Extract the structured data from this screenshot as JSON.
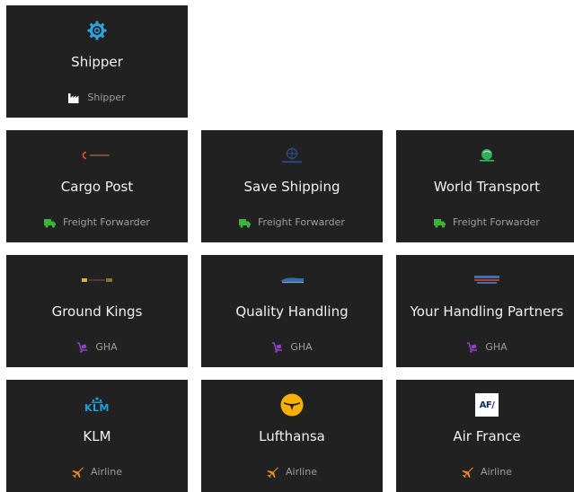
{
  "colors": {
    "tile_bg": "#212121",
    "shipper_icon": "#2ea3dd",
    "forwarder_icon": "#3cb43c",
    "gha_icon": "#8e44c8",
    "airline_icon": "#f08a24",
    "lufthansa_yellow": "#f9b000"
  },
  "tiles": [
    {
      "name": "Shipper",
      "role": "Shipper",
      "role_icon": "factory-icon",
      "logo": "gear-icon"
    },
    {
      "name": "Cargo Post",
      "role": "Freight Forwarder",
      "role_icon": "truck-icon",
      "logo": "cargo-post-logo"
    },
    {
      "name": "Save Shipping",
      "role": "Freight Forwarder",
      "role_icon": "truck-icon",
      "logo": "save-shipping-logo"
    },
    {
      "name": "World Transport",
      "role": "Freight Forwarder",
      "role_icon": "truck-icon",
      "logo": "world-transport-logo"
    },
    {
      "name": "Ground Kings",
      "role": "GHA",
      "role_icon": "dolly-icon",
      "logo": "ground-kings-logo"
    },
    {
      "name": "Quality Handling",
      "role": "GHA",
      "role_icon": "dolly-icon",
      "logo": "quality-handling-logo"
    },
    {
      "name": "Your Handling Partners",
      "role": "GHA",
      "role_icon": "dolly-icon",
      "logo": "your-handling-partners-logo"
    },
    {
      "name": "KLM",
      "role": "Airline",
      "role_icon": "plane-icon",
      "logo": "klm-logo",
      "logo_text": "KLM"
    },
    {
      "name": "Lufthansa",
      "role": "Airline",
      "role_icon": "plane-icon",
      "logo": "lufthansa-logo"
    },
    {
      "name": "Air France",
      "role": "Airline",
      "role_icon": "plane-icon",
      "logo": "air-france-logo",
      "logo_text": "AF/"
    }
  ]
}
